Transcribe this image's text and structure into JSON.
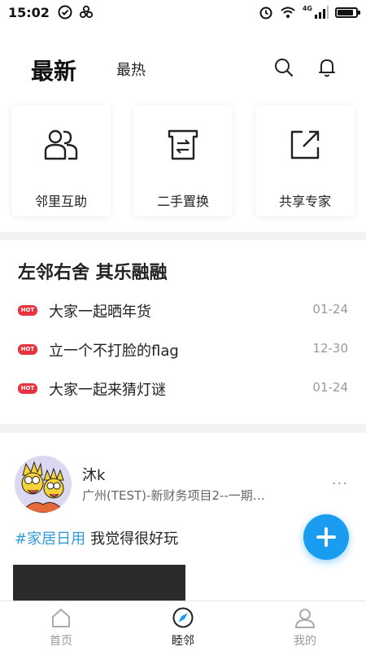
{
  "status_bar": {
    "time": "15:02",
    "network": "4G",
    "left_icons": [
      "check-circle-icon",
      "flower-icon"
    ],
    "right_icons": [
      "alarm-icon",
      "wifi-icon",
      "signal-icon",
      "battery-icon"
    ]
  },
  "header": {
    "tabs": [
      {
        "label": "最新",
        "active": true
      },
      {
        "label": "最热",
        "active": false
      }
    ],
    "icons": [
      "search-icon",
      "bell-icon"
    ]
  },
  "quick_actions": [
    {
      "label": "邻里互助",
      "icon": "people-icon"
    },
    {
      "label": "二手置换",
      "icon": "exchange-icon"
    },
    {
      "label": "共享专家",
      "icon": "share-icon"
    }
  ],
  "hot_topics": {
    "title": "左邻右舍 其乐融融",
    "badge": "HOT",
    "items": [
      {
        "text": "大家一起晒年货",
        "date": "01-24"
      },
      {
        "text": "立一个不打脸的flag",
        "date": "12-30"
      },
      {
        "text": "大家一起来猜灯谜",
        "date": "01-24"
      }
    ]
  },
  "post": {
    "user_name": "沐k",
    "location": "广州(TEST)-新财务项目2--一期…",
    "tag": "#家居日用",
    "text": "我觉得很好玩",
    "more": "···"
  },
  "bottom_nav": [
    {
      "label": "首页",
      "icon": "home-icon",
      "active": false
    },
    {
      "label": "睦邻",
      "icon": "compass-icon",
      "active": true
    },
    {
      "label": "我的",
      "icon": "person-icon",
      "active": false
    }
  ],
  "colors": {
    "accent": "#1a9cf0",
    "hot_badge": "#e8333f",
    "tag": "#2f9bdc"
  }
}
